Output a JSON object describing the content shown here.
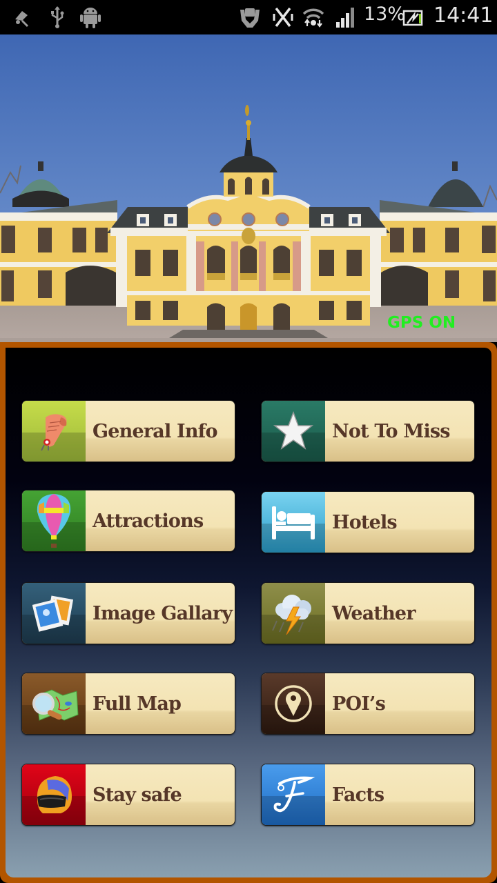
{
  "status_bar": {
    "left_icons": [
      "location-pin-off-icon",
      "usb-icon",
      "android-debug-icon"
    ],
    "right_icons": [
      "nfc-hand-icon",
      "vibrate-off-icon",
      "wifi-icon",
      "signal-icon",
      "battery-charging-icon"
    ],
    "battery_percent": "13%",
    "time": "14:41"
  },
  "hero": {
    "image_description": "baroque palace with yellow facade and central dome under blue sky",
    "gps_status": "GPS ON",
    "gps_color": "#21ee21"
  },
  "frame_color": "#b25500",
  "menu": {
    "items": [
      {
        "label": "General Info",
        "icon": "scroll-certificate-icon",
        "color": "#a9c23a"
      },
      {
        "label": "Not To Miss",
        "icon": "star-icon",
        "color": "#1e5f50"
      },
      {
        "label": "Attractions",
        "icon": "hot-air-balloon-icon",
        "color": "#3b8f28"
      },
      {
        "label": "Hotels",
        "icon": "bed-icon",
        "color": "#3ba8d6"
      },
      {
        "label": "Image Gallary",
        "icon": "photos-icon",
        "color": "#2c5068"
      },
      {
        "label": "Weather",
        "icon": "storm-cloud-icon",
        "color": "#7d7f32"
      },
      {
        "label": "Full Map",
        "icon": "map-magnifier-icon",
        "color": "#7a4a1a"
      },
      {
        "label": "POI’s",
        "icon": "map-pin-circle-icon",
        "color": "#4a2e1e"
      },
      {
        "label": "Stay safe",
        "icon": "helmet-icon",
        "color": "#c2061a"
      },
      {
        "label": "Facts",
        "icon": "letter-f-icon",
        "color": "#2a83d6"
      }
    ]
  }
}
